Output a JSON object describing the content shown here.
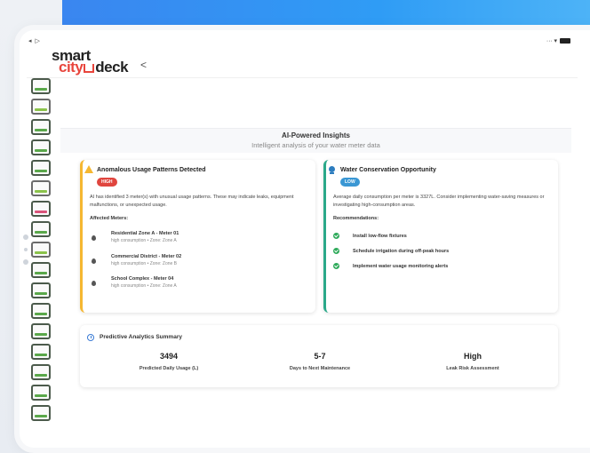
{
  "status_bar": {
    "left": "◂ ▷",
    "right": "··∙ ▾"
  },
  "logo": {
    "line1": "smart",
    "line2_a": "city",
    "line2_b": "deck"
  },
  "back_label": "<",
  "insights": {
    "title": "AI-Powered Insights",
    "subtitle": "Intelligent analysis of your water meter data"
  },
  "anomaly": {
    "title": "Anomalous Usage Patterns Detected",
    "badge": "HIGH",
    "description": "AI has identified 3 meter(s) with unusual usage patterns. These may indicate leaks, equipment malfunctions, or unexpected usage.",
    "meters_heading": "Affected Meters:",
    "meters": [
      {
        "name": "Residential Zone A - Meter 01",
        "info": "high consumption • Zone: Zone A"
      },
      {
        "name": "Commercial District - Meter 02",
        "info": "high consumption • Zone: Zone B"
      },
      {
        "name": "School Complex - Meter 04",
        "info": "high consumption • Zone: Zone A"
      }
    ]
  },
  "conservation": {
    "title": "Water Conservation Opportunity",
    "badge": "LOW",
    "description": "Average daily consumption per meter is 3327L. Consider implementing water-saving measures or investigating high-consumption areas.",
    "rec_heading": "Recommendations:",
    "recommendations": [
      "Install low-flow fixtures",
      "Schedule irrigation during off-peak hours",
      "Implement water usage monitoring alerts"
    ]
  },
  "summary": {
    "title": "Predictive Analytics Summary",
    "stats": [
      {
        "value": "3494",
        "label": "Predicted Daily Usage (L)"
      },
      {
        "value": "5-7",
        "label": "Days to Next Maintenance"
      },
      {
        "value": "High",
        "label": "Leak Risk Assessment"
      }
    ]
  },
  "colors": {
    "accent_blue": "#3a86f0",
    "warning": "#f5b731",
    "success": "#2aa889",
    "danger": "#e0453e"
  },
  "icons": [
    "warning-icon",
    "bulb-icon",
    "drop-icon",
    "check-icon",
    "clock-icon",
    "back-icon"
  ]
}
